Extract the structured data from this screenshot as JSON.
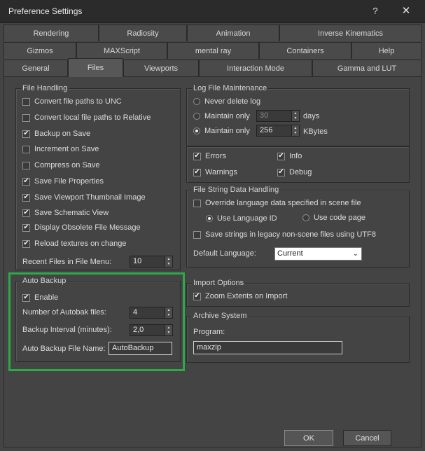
{
  "window": {
    "title": "Preference Settings",
    "help_label": "?",
    "close_label": "✕"
  },
  "tabs": {
    "row1": [
      "Rendering",
      "Radiosity",
      "Animation",
      "Inverse Kinematics"
    ],
    "row2": [
      "Gizmos",
      "MAXScript",
      "mental ray",
      "Containers",
      "Help"
    ],
    "row3": [
      "General",
      "Files",
      "Viewports",
      "Interaction Mode",
      "Gamma and LUT"
    ],
    "active": "Files"
  },
  "file_handling": {
    "title": "File Handling",
    "options": [
      {
        "label": "Convert file paths to UNC",
        "checked": false
      },
      {
        "label": "Convert local file paths to Relative",
        "checked": false
      },
      {
        "label": "Backup on Save",
        "checked": true
      },
      {
        "label": "Increment on Save",
        "checked": false
      },
      {
        "label": "Compress on Save",
        "checked": false
      },
      {
        "label": "Save File Properties",
        "checked": true
      },
      {
        "label": "Save Viewport Thumbnail Image",
        "checked": true
      },
      {
        "label": "Save Schematic View",
        "checked": true
      },
      {
        "label": "Display Obsolete File Message",
        "checked": true
      },
      {
        "label": "Reload textures on change",
        "checked": true
      }
    ],
    "recent_label": "Recent Files in File Menu:",
    "recent_value": "10"
  },
  "auto_backup": {
    "title": "Auto Backup",
    "enable_label": "Enable",
    "enable_checked": true,
    "num_files_label": "Number of Autobak files:",
    "num_files_value": "4",
    "interval_label": "Backup Interval (minutes):",
    "interval_value": "2,0",
    "filename_label": "Auto Backup File Name:",
    "filename_value": "AutoBackup",
    "highlight_color": "#2ea94a"
  },
  "log_file": {
    "title": "Log File Maintenance",
    "never_label": "Never delete log",
    "maintain_days_label": "Maintain only",
    "days_value": "30",
    "days_unit": "days",
    "maintain_kb_label": "Maintain only",
    "kb_value": "256",
    "kb_unit": "KBytes",
    "selected": "kbytes",
    "errors_label": "Errors",
    "info_label": "Info",
    "warnings_label": "Warnings",
    "debug_label": "Debug"
  },
  "file_string": {
    "title": "File String Data Handling",
    "override_label": "Override language data specified in scene file",
    "use_lang_label": "Use Language ID",
    "use_code_label": "Use code page",
    "legacy_label": "Save strings in legacy non-scene files using UTF8",
    "default_lang_label": "Default Language:",
    "default_lang_value": "Current"
  },
  "import_options": {
    "title": "Import Options",
    "zoom_label": "Zoom Extents on Import"
  },
  "archive": {
    "title": "Archive System",
    "program_label": "Program:",
    "program_value": "maxzip"
  },
  "buttons": {
    "ok": "OK",
    "cancel": "Cancel"
  }
}
